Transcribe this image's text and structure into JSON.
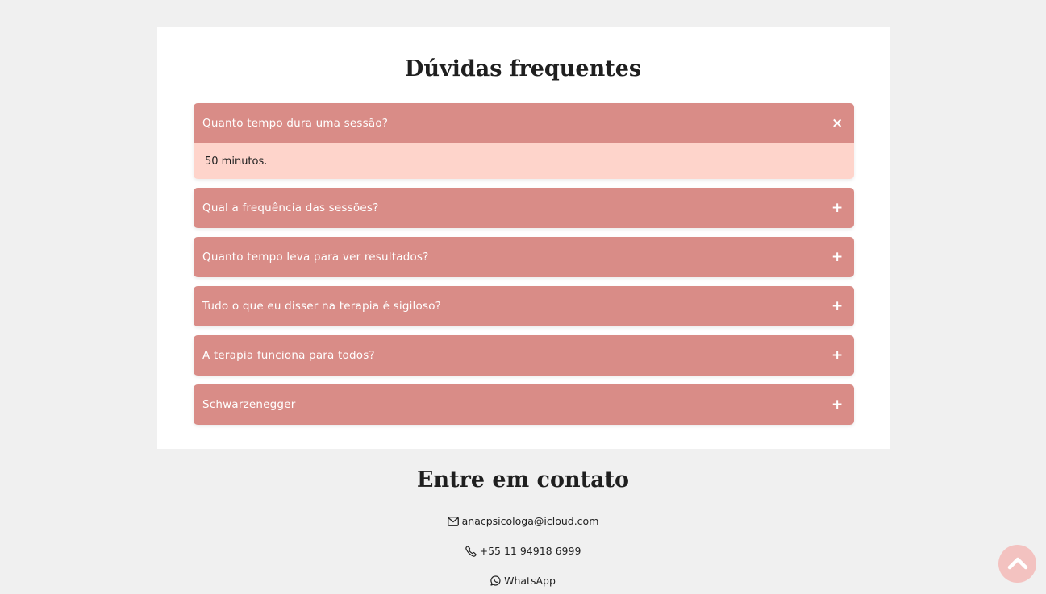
{
  "faq": {
    "title": "Dúvidas frequentes",
    "items": [
      {
        "question": "Quanto tempo dura uma sessão?",
        "answer": "50 minutos.",
        "expanded": true,
        "toggle": "×"
      },
      {
        "question": "Qual a frequência das sessões?",
        "expanded": false,
        "toggle": "+"
      },
      {
        "question": "Quanto tempo leva para ver resultados?",
        "expanded": false,
        "toggle": "+"
      },
      {
        "question": "Tudo o que eu disser na terapia é sigiloso?",
        "expanded": false,
        "toggle": "+"
      },
      {
        "question": "A terapia funciona para todos?",
        "expanded": false,
        "toggle": "+"
      },
      {
        "question": "Schwarzenegger",
        "expanded": false,
        "toggle": "+"
      }
    ]
  },
  "contact": {
    "title": "Entre em contato",
    "email": {
      "icon": "envelope-icon",
      "text": "anacpsicologa@icloud.com"
    },
    "phone": {
      "icon": "phone-icon",
      "text": "+55 11 94918 6999"
    },
    "whatsapp": {
      "icon": "whatsapp-icon",
      "text": "WhatsApp"
    }
  },
  "scroll_top": {
    "icon": "chevron-up-icon"
  },
  "colors": {
    "page_background": "#f0f0f0",
    "card_background": "#ffffff",
    "accordion_header": "#d98c87",
    "accordion_answer": "#fed4cb",
    "scroll_top_button": "#f3c2c0"
  }
}
